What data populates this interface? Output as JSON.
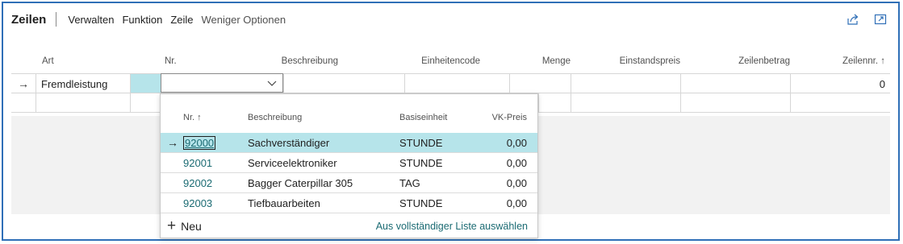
{
  "actionbar": {
    "title": "Zeilen",
    "menu": [
      "Verwalten",
      "Funktion",
      "Zeile",
      "Weniger Optionen"
    ],
    "icons": [
      "share-icon",
      "expand-icon"
    ]
  },
  "grid": {
    "columns": [
      "Art",
      "Nr.",
      "Beschreibung",
      "Einheitencode",
      "Menge",
      "Einstandspreis",
      "Zeilenbetrag",
      "Zeilennr. ↑"
    ],
    "current_row": {
      "indicator": "→",
      "art": "Fremdleistung",
      "nr": "",
      "zeilennr": "0"
    }
  },
  "lookup": {
    "columns": [
      "Nr. ↑",
      "Beschreibung",
      "Basiseinheit",
      "VK-Preis"
    ],
    "rows": [
      {
        "nr": "92000",
        "beschreibung": "Sachverständiger",
        "basiseinheit": "STUNDE",
        "vk_preis": "0,00",
        "selected": true
      },
      {
        "nr": "92001",
        "beschreibung": "Serviceelektroniker",
        "basiseinheit": "STUNDE",
        "vk_preis": "0,00"
      },
      {
        "nr": "92002",
        "beschreibung": "Bagger Caterpillar 305",
        "basiseinheit": "TAG",
        "vk_preis": "0,00"
      },
      {
        "nr": "92003",
        "beschreibung": "Tiefbauarbeiten",
        "basiseinheit": "STUNDE",
        "vk_preis": "0,00"
      }
    ],
    "selected_indicator": "→",
    "new_icon": "+",
    "new_label": "Neu",
    "full_list_label": "Aus vollständiger Liste auswählen"
  },
  "colors": {
    "frame": "#2f6fb7",
    "selected_row": "#b6e4ea",
    "link": "#1b6b73"
  }
}
